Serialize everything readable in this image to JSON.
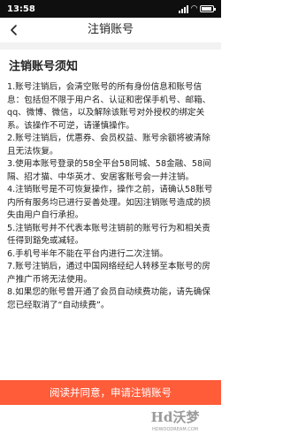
{
  "status_bar": {
    "time": "13:58",
    "battery_level": 0.9
  },
  "header": {
    "title": "注销账号",
    "back_icon": "chevron-left-icon"
  },
  "notice": {
    "heading": "注销账号须知",
    "paragraphs": [
      "1.账号注销后，会清空账号的所有身份信息和账号信息：包括但不限于用户名、认证和密保手机号、邮箱、qq、微博、微信，以及解除该账号对外授权的绑定关系。该操作不可逆，请谨慎操作。",
      "2.账号注销后，优惠券、会员权益、账号余额将被清除且无法恢复。",
      "3.使用本账号登录的58全平台58同城、58金融、58间隔、招才猫、中华英才、安居客账号会一并注销。",
      "4.注销账号是不可恢复操作，操作之前，请确认58账号内所有服务均已进行妥善处理。如因注销账号造成的损失由用户自行承担。",
      "5.注销账号并不代表本账号注销前的账号行为和相关责任得到豁免或减轻。",
      "6.手机号半年不能在平台内进行二次注销。",
      "7.账号注销后，通过中国网络经纪人转移至本账号的房产推广币将无法使用。",
      "8.如果您的账号曾开通了会员自动续费功能，请先确保您已经取消了“自动续费”。"
    ]
  },
  "footer": {
    "apply_button_label": "阅读并同意，申请注销账号",
    "accent_color": "#ff5c3a"
  },
  "watermark": {
    "logo_text": "Hd沃梦",
    "url": "HDWOODREAM.COM"
  }
}
